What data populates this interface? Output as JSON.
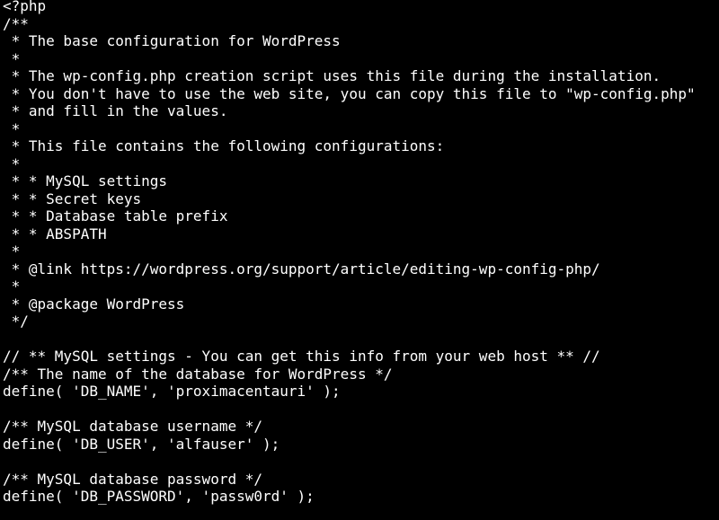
{
  "colors": {
    "background": "#000000",
    "text": "#ffffff"
  },
  "lines": [
    "<?php",
    "/**",
    " * The base configuration for WordPress",
    " *",
    " * The wp-config.php creation script uses this file during the installation.",
    " * You don't have to use the web site, you can copy this file to \"wp-config.php\"",
    " * and fill in the values.",
    " *",
    " * This file contains the following configurations:",
    " *",
    " * * MySQL settings",
    " * * Secret keys",
    " * * Database table prefix",
    " * * ABSPATH",
    " *",
    " * @link https://wordpress.org/support/article/editing-wp-config-php/",
    " *",
    " * @package WordPress",
    " */",
    "",
    "// ** MySQL settings - You can get this info from your web host ** //",
    "/** The name of the database for WordPress */",
    "define( 'DB_NAME', 'proximacentauri' );",
    "",
    "/** MySQL database username */",
    "define( 'DB_USER', 'alfauser' );",
    "",
    "/** MySQL database password */",
    "define( 'DB_PASSWORD', 'passw0rd' );"
  ]
}
